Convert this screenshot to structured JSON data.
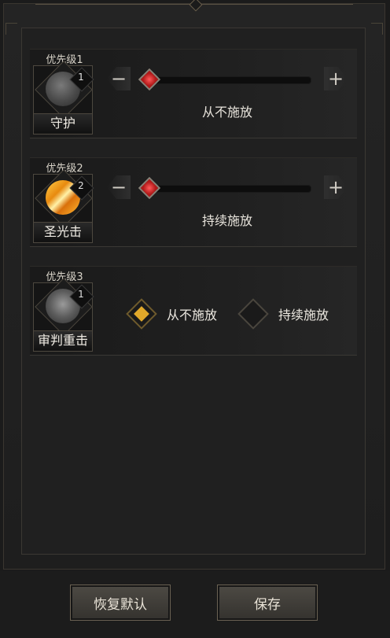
{
  "skills": [
    {
      "priority_label": "优先级1",
      "name": "守护",
      "rank": "1",
      "icon": "shield-spiral-icon",
      "control": "slider",
      "slider_value": 0,
      "mode_text": "从不施放"
    },
    {
      "priority_label": "优先级2",
      "name": "圣光击",
      "rank": "2",
      "icon": "holy-light-strike-icon",
      "control": "slider",
      "slider_value": 0,
      "mode_text": "持续施放"
    },
    {
      "priority_label": "优先级3",
      "name": "审判重击",
      "rank": "1",
      "icon": "judgment-strike-icon",
      "control": "options",
      "options": [
        {
          "label": "从不施放",
          "checked": true
        },
        {
          "label": "持续施放",
          "checked": false
        }
      ]
    }
  ],
  "controls": {
    "minus_symbol": "−",
    "plus_symbol": "+"
  },
  "footer": {
    "reset_label": "恢复默认",
    "save_label": "保存"
  },
  "colors": {
    "accent_gold": "#e0a82a",
    "slider_thumb_red": "#d02a2a",
    "background": "#1b1b1b"
  }
}
